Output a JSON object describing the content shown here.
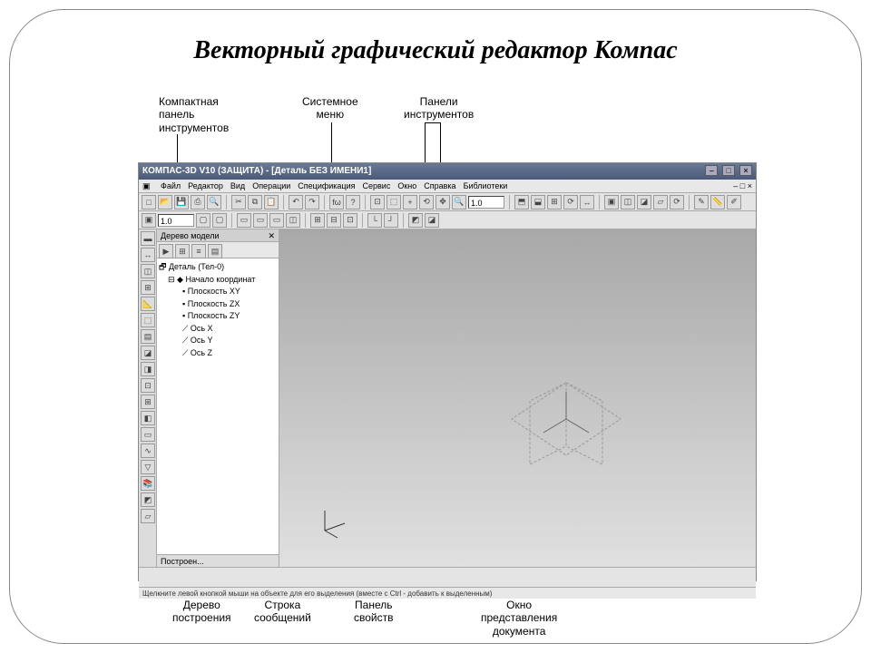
{
  "slide": {
    "title": "Векторный графический редактор Компас"
  },
  "labels": {
    "top": {
      "compact_panel": "Компактная\nпанель\nинструментов",
      "system_menu": "Системное\nменю",
      "tool_panels": "Панели\nинструментов"
    },
    "bottom": {
      "model_tree": "Дерево\nпостроения",
      "message_line": "Строка\nсообщений",
      "property_panel": "Панель\nсвойств",
      "view_window": "Окно\nпредставления\nдокумента"
    }
  },
  "app": {
    "title": "КОМПАС-3D V10 (ЗАЩИТА) - [Деталь БЕЗ ИМЕНИ1]",
    "doc_close": "– □ ×",
    "menu": [
      "Файл",
      "Редактор",
      "Вид",
      "Операции",
      "Спецификация",
      "Сервис",
      "Окно",
      "Справка",
      "Библиотеки"
    ],
    "zoom1": "1.0",
    "zoom2": "1.0",
    "tree": {
      "title": "Дерево модели",
      "close": "✕",
      "root": "Деталь (Тел-0)",
      "origin": "Начало координат",
      "items": [
        "Плоскость XY",
        "Плоскость ZX",
        "Плоскость ZY",
        "Ось X",
        "Ось Y",
        "Ось Z"
      ],
      "tab": "Построен..."
    },
    "status": "Щелкните левой кнопкой мыши на объекте для его выделения (вместе с Ctrl - добавить к выделенным)"
  }
}
